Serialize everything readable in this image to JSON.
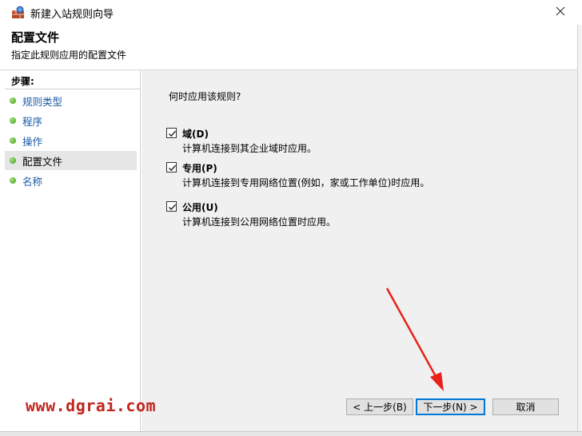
{
  "window": {
    "title": "新建入站规则向导",
    "icon": "firewall-icon",
    "close_glyph": "✕"
  },
  "header": {
    "title": "配置文件",
    "description": "指定此规则应用的配置文件"
  },
  "sidebar": {
    "steps_label": "步骤:",
    "items": [
      {
        "label": "规则类型"
      },
      {
        "label": "程序"
      },
      {
        "label": "操作"
      },
      {
        "label": "配置文件"
      },
      {
        "label": "名称"
      }
    ]
  },
  "main": {
    "question": "何时应用该规则?",
    "options": [
      {
        "label": "域(D)",
        "description": "计算机连接到其企业域时应用。",
        "checked": true
      },
      {
        "label": "专用(P)",
        "description": "计算机连接到专用网络位置(例如，家或工作单位)时应用。",
        "checked": true
      },
      {
        "label": "公用(U)",
        "description": "计算机连接到公用网络位置时应用。",
        "checked": true
      }
    ]
  },
  "buttons": {
    "back": "< 上一步(B)",
    "next": "下一步(N) >",
    "cancel": "取消"
  },
  "watermark": "www.dgrai.com",
  "colors": {
    "step_link": "#1a5aa6",
    "step_dot": "#3c9a1c",
    "content_bg": "#f0f0f0",
    "accent_border": "#0078d7",
    "watermark": "#c0261f",
    "arrow": "#e8221b"
  }
}
